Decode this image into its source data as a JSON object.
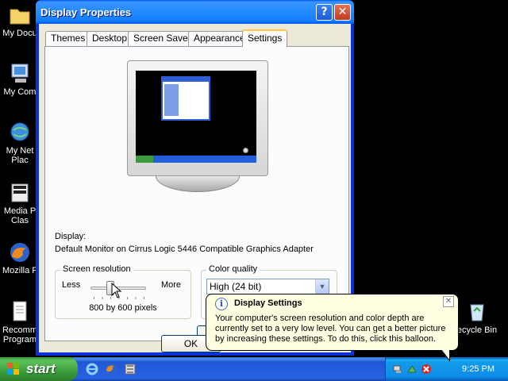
{
  "desktop": {
    "icons": [
      {
        "label": "My Docu",
        "glyph": "folder-icon"
      },
      {
        "label": "My Com",
        "glyph": "computer-icon"
      },
      {
        "label": "My Net",
        "label2": "Plac",
        "glyph": "network-icon"
      },
      {
        "label": "Media P",
        "label2": "Clas",
        "glyph": "media-player-icon"
      },
      {
        "label": "Mozilla F",
        "glyph": "firefox-icon"
      },
      {
        "label": "Recomm",
        "label2": "Program",
        "glyph": "document-icon"
      },
      {
        "label": "ecycle Bin",
        "glyph": "recycle-bin-icon"
      }
    ]
  },
  "window": {
    "title": "Display Properties",
    "help_label": "?",
    "close_label": "✕",
    "tabs": [
      {
        "label": "Themes"
      },
      {
        "label": "Desktop"
      },
      {
        "label": "Screen Saver"
      },
      {
        "label": "Appearance"
      },
      {
        "label": "Settings",
        "active": true
      }
    ],
    "display_label": "Display:",
    "display_value": "Default Monitor on Cirrus Logic 5446 Compatible Graphics Adapter",
    "resolution": {
      "legend": "Screen resolution",
      "less": "Less",
      "more": "More",
      "value_text": "800 by 600 pixels",
      "slider_fraction": 0.33
    },
    "color_quality": {
      "legend": "Color quality",
      "selected": "High (24 bit)"
    },
    "ok_label": "OK"
  },
  "balloon": {
    "title": "Display Settings",
    "text": "Your computer's screen resolution and color depth are currently set to a very low level. You can get a better picture by increasing these settings. To do this, click this balloon.",
    "close_label": "✕"
  },
  "taskbar": {
    "start_label": "start",
    "clock": "9:25 PM"
  }
}
